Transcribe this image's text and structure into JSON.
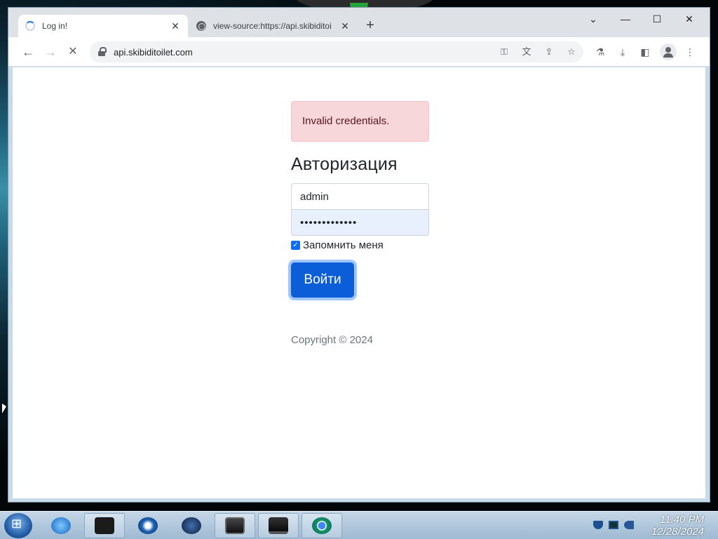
{
  "browser": {
    "tabs": [
      {
        "title": "Log in!",
        "icon": "loading-spinner",
        "active": true
      },
      {
        "title": "view-source:https://api.skibiditoi",
        "icon": "globe-icon",
        "active": false
      }
    ],
    "close_glyph": "✕",
    "new_tab_glyph": "+",
    "window_controls": {
      "tab_search": "⌄",
      "minimize": "—",
      "maximize": "☐",
      "close": "✕"
    },
    "nav": {
      "back": "←",
      "forward": "→",
      "stop": "✕"
    },
    "address": "api.skibiditoilet.com",
    "omnibox_icons": [
      "key-icon",
      "translate-icon",
      "share-icon",
      "star-icon"
    ],
    "toolbar_icons": [
      "labs-icon",
      "download-icon",
      "side-panel-icon",
      "profile-icon",
      "menu-icon"
    ],
    "menu_glyph": "⋮"
  },
  "page": {
    "alert": "Invalid credentials.",
    "heading": "Авторизация",
    "username_value": "admin",
    "password_value": "•••••••••••••",
    "remember_label": "Запомнить меня",
    "remember_checked": true,
    "submit_label": "Войти",
    "copyright": "Copyright © 2024"
  },
  "taskbar": {
    "apps": [
      "start-button",
      "internet-explorer",
      "terminal",
      "media-player",
      "globe-app",
      "window-app",
      "monitor-app",
      "chrome"
    ],
    "clock_time": "11:40 PM",
    "clock_date": "12/28/2024"
  },
  "colors": {
    "alert_bg": "#f8d7da",
    "primary": "#0b5ed7",
    "taskbar": "#b4cbe0"
  }
}
